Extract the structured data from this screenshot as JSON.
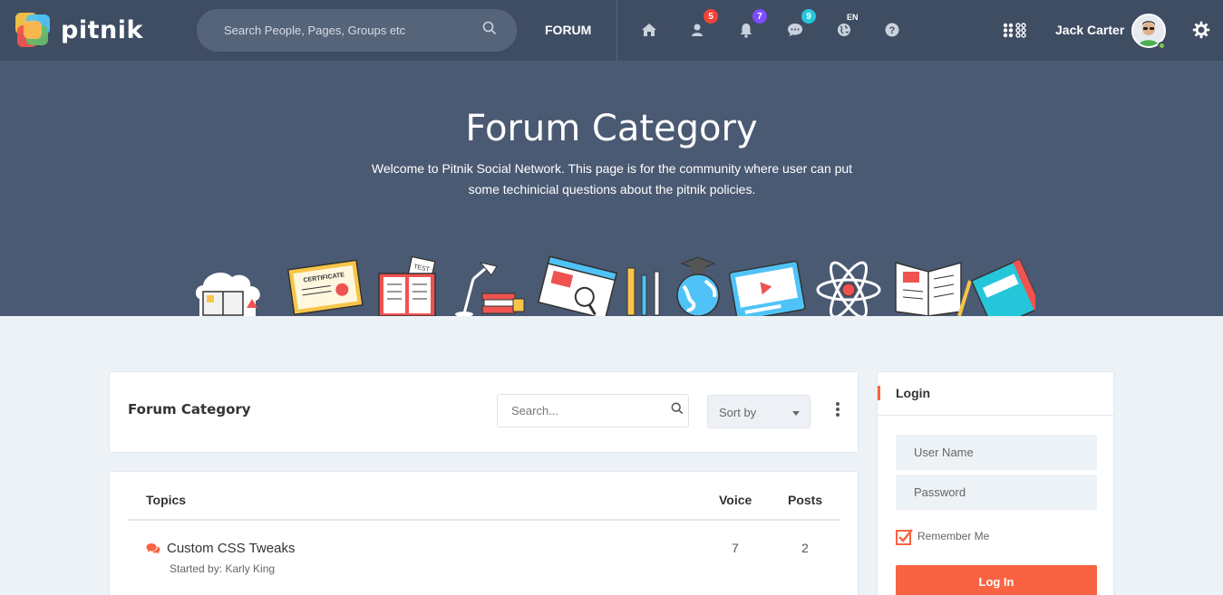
{
  "app": {
    "logo_text": "pitnik"
  },
  "topbar": {
    "search_placeholder": "Search People, Pages, Groups etc",
    "forum_label": "FORUM",
    "icons": [
      {
        "name": "home-icon"
      },
      {
        "name": "friend-requests-icon",
        "badge": "5",
        "badge_color": "#f44336"
      },
      {
        "name": "notifications-icon",
        "badge": "7",
        "badge_color": "#7c4dff"
      },
      {
        "name": "messages-icon",
        "badge": "9",
        "badge_color": "#26c6da"
      },
      {
        "name": "language-globe-icon",
        "label": "EN"
      },
      {
        "name": "help-icon"
      }
    ],
    "user_name": "Jack Carter",
    "apps_icon": "apps-grid-icon",
    "settings_icon": "gear-icon"
  },
  "hero": {
    "title": "Forum Category",
    "description": "Welcome to Pitnik Social Network. This page is for the community where user can put some techinicial questions about the pitnik policies."
  },
  "forum_header": {
    "title": "Forum Category",
    "search_placeholder": "Search...",
    "sort_label": "Sort by"
  },
  "topics": {
    "headers": {
      "topics": "Topics",
      "voice": "Voice",
      "posts": "Posts"
    },
    "rows": [
      {
        "title": "Custom CSS Tweaks",
        "started_by": "Started by: Karly King",
        "voice": "7",
        "posts": "2"
      }
    ]
  },
  "login": {
    "title": "Login",
    "username_placeholder": "User Name",
    "password_placeholder": "Password",
    "remember_label": "Remember Me",
    "button_label": "Log In"
  },
  "colors": {
    "topbar": "#3f4d63",
    "hero": "#4b5a73",
    "accent": "#fa6342",
    "page_bg": "#edf2f6"
  }
}
